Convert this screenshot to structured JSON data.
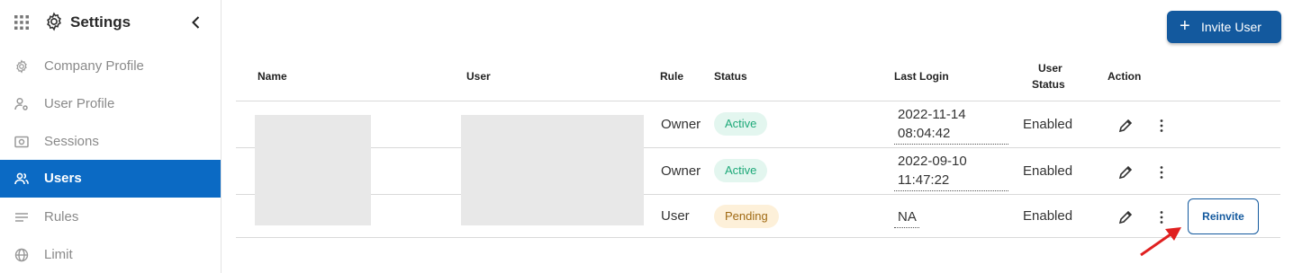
{
  "sidebar": {
    "title": "Settings",
    "items": [
      {
        "label": "Company Profile",
        "icon": "gear-icon"
      },
      {
        "label": "User Profile",
        "icon": "user-gear-icon"
      },
      {
        "label": "Sessions",
        "icon": "sessions-icon"
      },
      {
        "label": "Users",
        "icon": "users-icon",
        "active": true
      },
      {
        "label": "Rules",
        "icon": "rules-icon"
      },
      {
        "label": "Limit",
        "icon": "globe-icon"
      }
    ],
    "active_color": "#0b6ac4"
  },
  "toolbar": {
    "invite_label": "Invite User",
    "invite_color": "#13599e"
  },
  "table": {
    "columns": {
      "name": "Name",
      "user": "User",
      "rule": "Rule",
      "status": "Status",
      "last_login": "Last Login",
      "user_status_1": "User",
      "user_status_2": "Status",
      "action": "Action"
    },
    "rows": [
      {
        "rule": "Owner",
        "status": "Active",
        "last_login_date": "2022-11-14",
        "last_login_time": "08:04:42",
        "user_status": "Enabled"
      },
      {
        "rule": "Owner",
        "status": "Active",
        "last_login_date": "2022-09-10",
        "last_login_time": "11:47:22",
        "user_status": "Enabled"
      },
      {
        "rule": "User",
        "status": "Pending",
        "last_login_date": "NA",
        "last_login_time": "",
        "user_status": "Enabled",
        "reinvite_label": "Reinvite"
      }
    ]
  },
  "annotation": {
    "arrow_color": "#e02020"
  }
}
